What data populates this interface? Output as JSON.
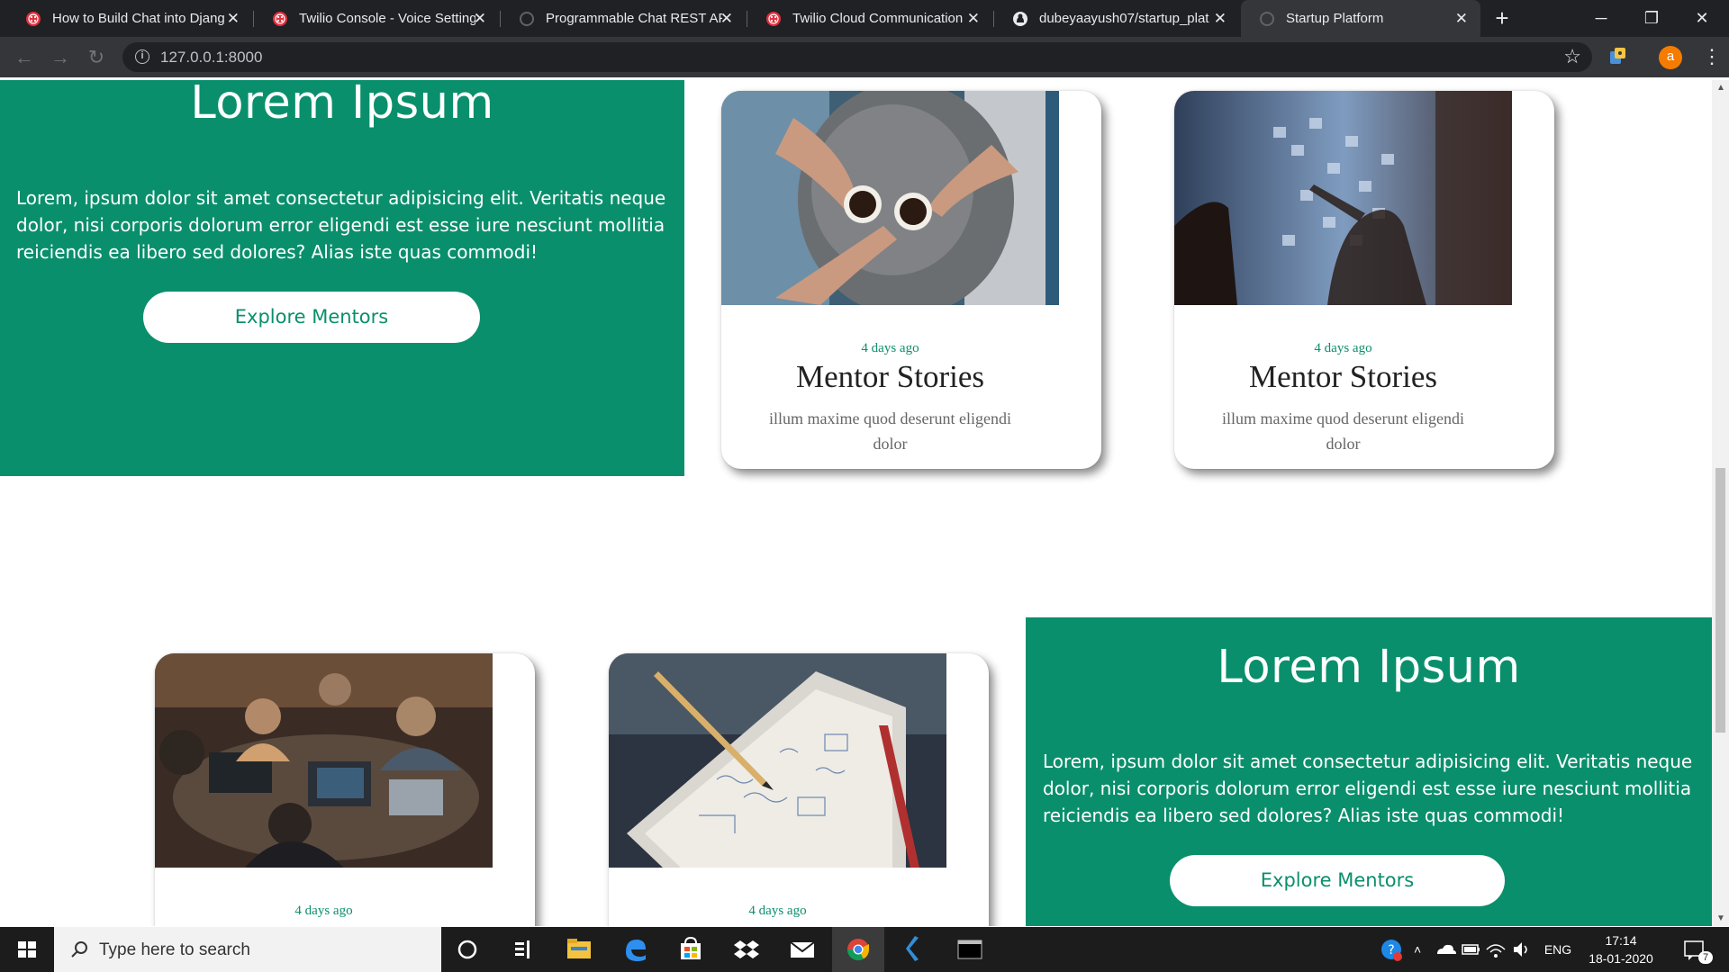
{
  "browser": {
    "tabs": [
      {
        "title": "How to Build Chat into Djang",
        "favicon": "twilio-icon",
        "active": false
      },
      {
        "title": "Twilio Console - Voice Setting",
        "favicon": "twilio-icon",
        "active": false
      },
      {
        "title": "Programmable Chat REST AP",
        "favicon": "loading-icon",
        "active": false
      },
      {
        "title": "Twilio Cloud Communication",
        "favicon": "twilio-icon",
        "active": false
      },
      {
        "title": "dubeyaayush07/startup_plat",
        "favicon": "github-icon",
        "active": false
      },
      {
        "title": "Startup Platform",
        "favicon": "loading-icon",
        "active": true
      }
    ],
    "url": "127.0.0.1:8000",
    "profile_initial": "a"
  },
  "page": {
    "hero_top": {
      "heading": "Lorem Ipsum",
      "body": "Lorem, ipsum dolor sit amet consectetur adipisicing elit. Veritatis neque dolor, nisi corporis dolorum error eligendi est esse iure nesciunt mollitia reiciendis ea libero sed dolores? Alias iste quas commodi!",
      "button": "Explore Mentors"
    },
    "hero_bottom": {
      "heading": "Lorem Ipsum",
      "body": "Lorem, ipsum dolor sit amet consectetur adipisicing elit. Veritatis neque dolor, nisi corporis dolorum error eligendi est esse iure nesciunt mollitia reiciendis ea libero sed dolores? Alias iste quas commodi!",
      "button": "Explore Mentors"
    },
    "cards": [
      {
        "date": "4 days ago",
        "title": "Mentor Stories",
        "desc": "illum maxime quod deserunt eligendi dolor",
        "photo": "coffee-table-photo"
      },
      {
        "date": "4 days ago",
        "title": "Mentor Stories",
        "desc": "illum maxime quod deserunt eligendi dolor",
        "photo": "sticky-notes-wall-photo"
      },
      {
        "date": "4 days ago",
        "title": "",
        "desc": "",
        "photo": "team-laptops-photo"
      },
      {
        "date": "4 days ago",
        "title": "",
        "desc": "",
        "photo": "notebook-pencil-photo"
      }
    ],
    "colors": {
      "brand_green": "#0a8f6c",
      "card_bg": "#ffffff"
    }
  },
  "taskbar": {
    "search_placeholder": "Type here to search",
    "language": "ENG",
    "time": "17:14",
    "date": "18-01-2020",
    "notification_count": "7"
  }
}
